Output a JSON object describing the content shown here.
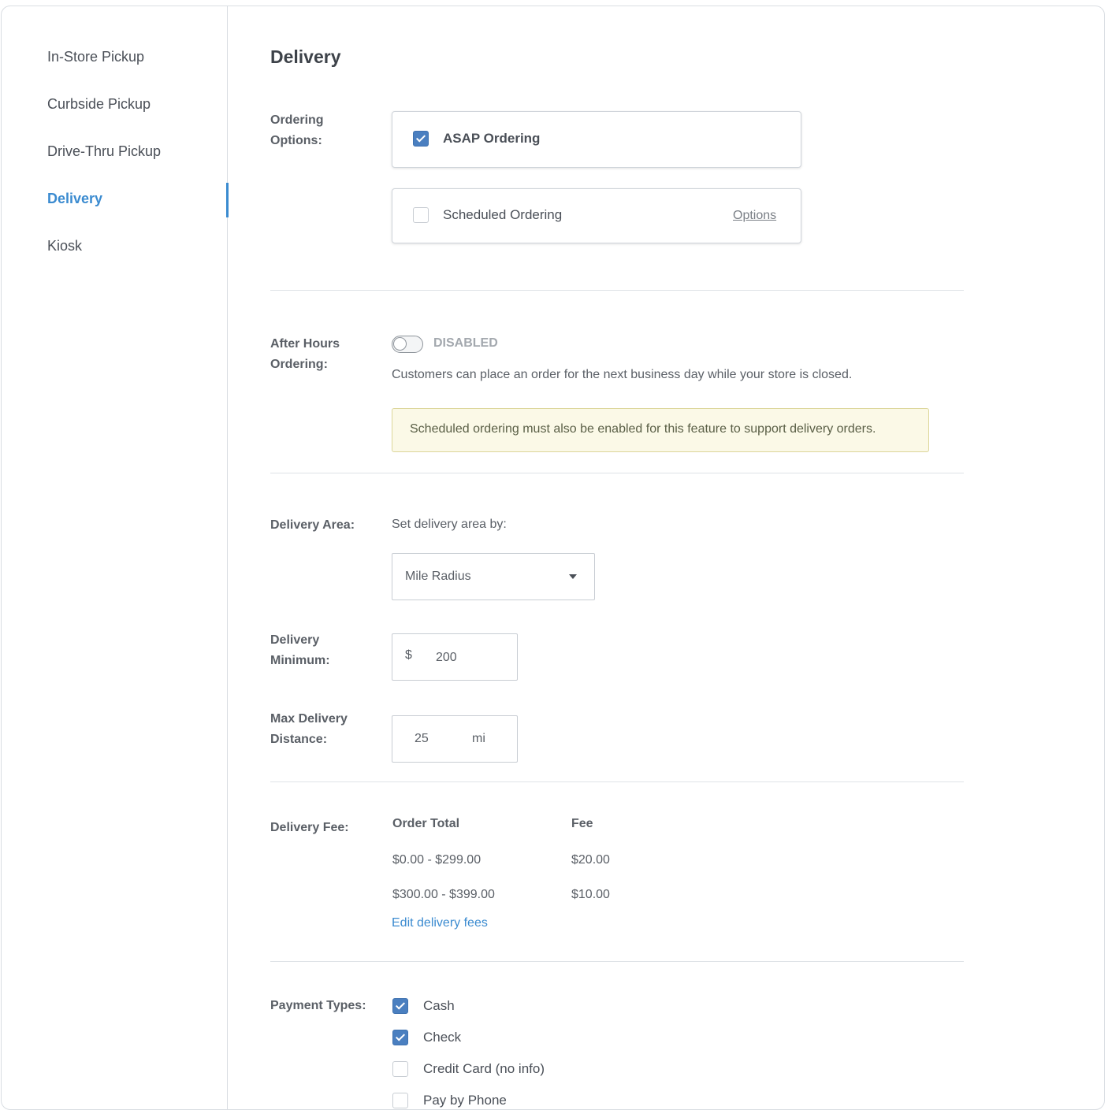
{
  "sidebar": {
    "items": [
      {
        "label": "In-Store Pickup",
        "active": false
      },
      {
        "label": "Curbside Pickup",
        "active": false
      },
      {
        "label": "Drive-Thru Pickup",
        "active": false
      },
      {
        "label": "Delivery",
        "active": true
      },
      {
        "label": "Kiosk",
        "active": false
      }
    ]
  },
  "page": {
    "title": "Delivery"
  },
  "ordering_options": {
    "label_line1": "Ordering",
    "label_line2": "Options:",
    "asap": {
      "label": "ASAP Ordering",
      "checked": true
    },
    "scheduled": {
      "label": "Scheduled Ordering",
      "checked": false,
      "options_link": "Options"
    }
  },
  "after_hours": {
    "label_line1": "After Hours",
    "label_line2": "Ordering:",
    "toggle_state": "DISABLED",
    "enabled": false,
    "description": "Customers can place an order for the next business day while your store is closed.",
    "notice": "Scheduled ordering must also be enabled for this feature to support delivery orders."
  },
  "delivery_area": {
    "label": "Delivery Area:",
    "prompt": "Set delivery area by:",
    "selected": "Mile Radius"
  },
  "delivery_minimum": {
    "label_line1": "Delivery",
    "label_line2": "Minimum:",
    "currency_symbol": "$",
    "value": "200"
  },
  "max_distance": {
    "label_line1": "Max Delivery",
    "label_line2": "Distance:",
    "value": "25",
    "unit": "mi"
  },
  "delivery_fee": {
    "label": "Delivery Fee:",
    "columns": [
      "Order Total",
      "Fee"
    ],
    "rows": [
      {
        "range": "$0.00 - $299.00",
        "fee": "$20.00"
      },
      {
        "range": "$300.00 - $399.00",
        "fee": "$10.00"
      }
    ],
    "edit_link": "Edit delivery fees"
  },
  "payment_types": {
    "label": "Payment Types:",
    "items": [
      {
        "label": "Cash",
        "checked": true
      },
      {
        "label": "Check",
        "checked": true
      },
      {
        "label": "Credit Card (no info)",
        "checked": false
      },
      {
        "label": "Pay by Phone",
        "checked": false
      }
    ]
  },
  "colors": {
    "accent": "#3b8bd0",
    "checkbox_checked": "#4a7fc0",
    "notice_bg": "#fbf9e7",
    "notice_border": "#dcd69a"
  }
}
